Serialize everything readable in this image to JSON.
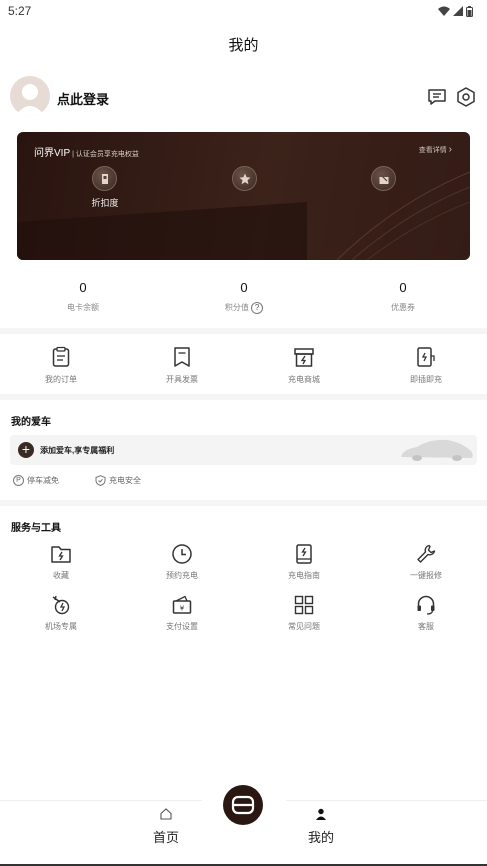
{
  "status_bar": {
    "time": "5:27"
  },
  "header": {
    "title": "我的"
  },
  "profile": {
    "login_text": "点此登录"
  },
  "vip_card": {
    "title": "问界VIP",
    "subtitle": "| 认证会员享充电权益",
    "more": "查看详情",
    "benefits": [
      {
        "label": "折扣度"
      },
      {
        "label": ""
      },
      {
        "label": ""
      }
    ]
  },
  "stats": [
    {
      "value": "0",
      "label": "电卡余额"
    },
    {
      "value": "0",
      "label": "积分值"
    },
    {
      "value": "0",
      "label": "优惠券"
    }
  ],
  "quick_actions": [
    {
      "label": "我的订单",
      "icon": "order-icon"
    },
    {
      "label": "开具发票",
      "icon": "invoice-icon"
    },
    {
      "label": "充电商城",
      "icon": "mall-icon"
    },
    {
      "label": "即插即充",
      "icon": "plug-charge-icon"
    }
  ],
  "my_car": {
    "title": "我的爱车",
    "add_text": "添加爱车,享专属福利",
    "perks": [
      {
        "label": "停车减免"
      },
      {
        "label": "充电安全"
      }
    ]
  },
  "services": {
    "title": "服务与工具",
    "items": [
      {
        "label": "收藏",
        "icon": "favorite-folder-icon"
      },
      {
        "label": "预约充电",
        "icon": "clock-icon"
      },
      {
        "label": "充电指南",
        "icon": "guide-book-icon"
      },
      {
        "label": "一键报修",
        "icon": "wrench-icon"
      },
      {
        "label": "机场专属",
        "icon": "airport-icon"
      },
      {
        "label": "支付设置",
        "icon": "wallet-icon"
      },
      {
        "label": "常见问题",
        "icon": "faq-grid-icon"
      },
      {
        "label": "客服",
        "icon": "headset-icon"
      }
    ]
  },
  "tabbar": {
    "home": "首页",
    "mine": "我的"
  },
  "colors": {
    "brand_dark": "#2b1712",
    "vip_bg": "#3c231a"
  }
}
